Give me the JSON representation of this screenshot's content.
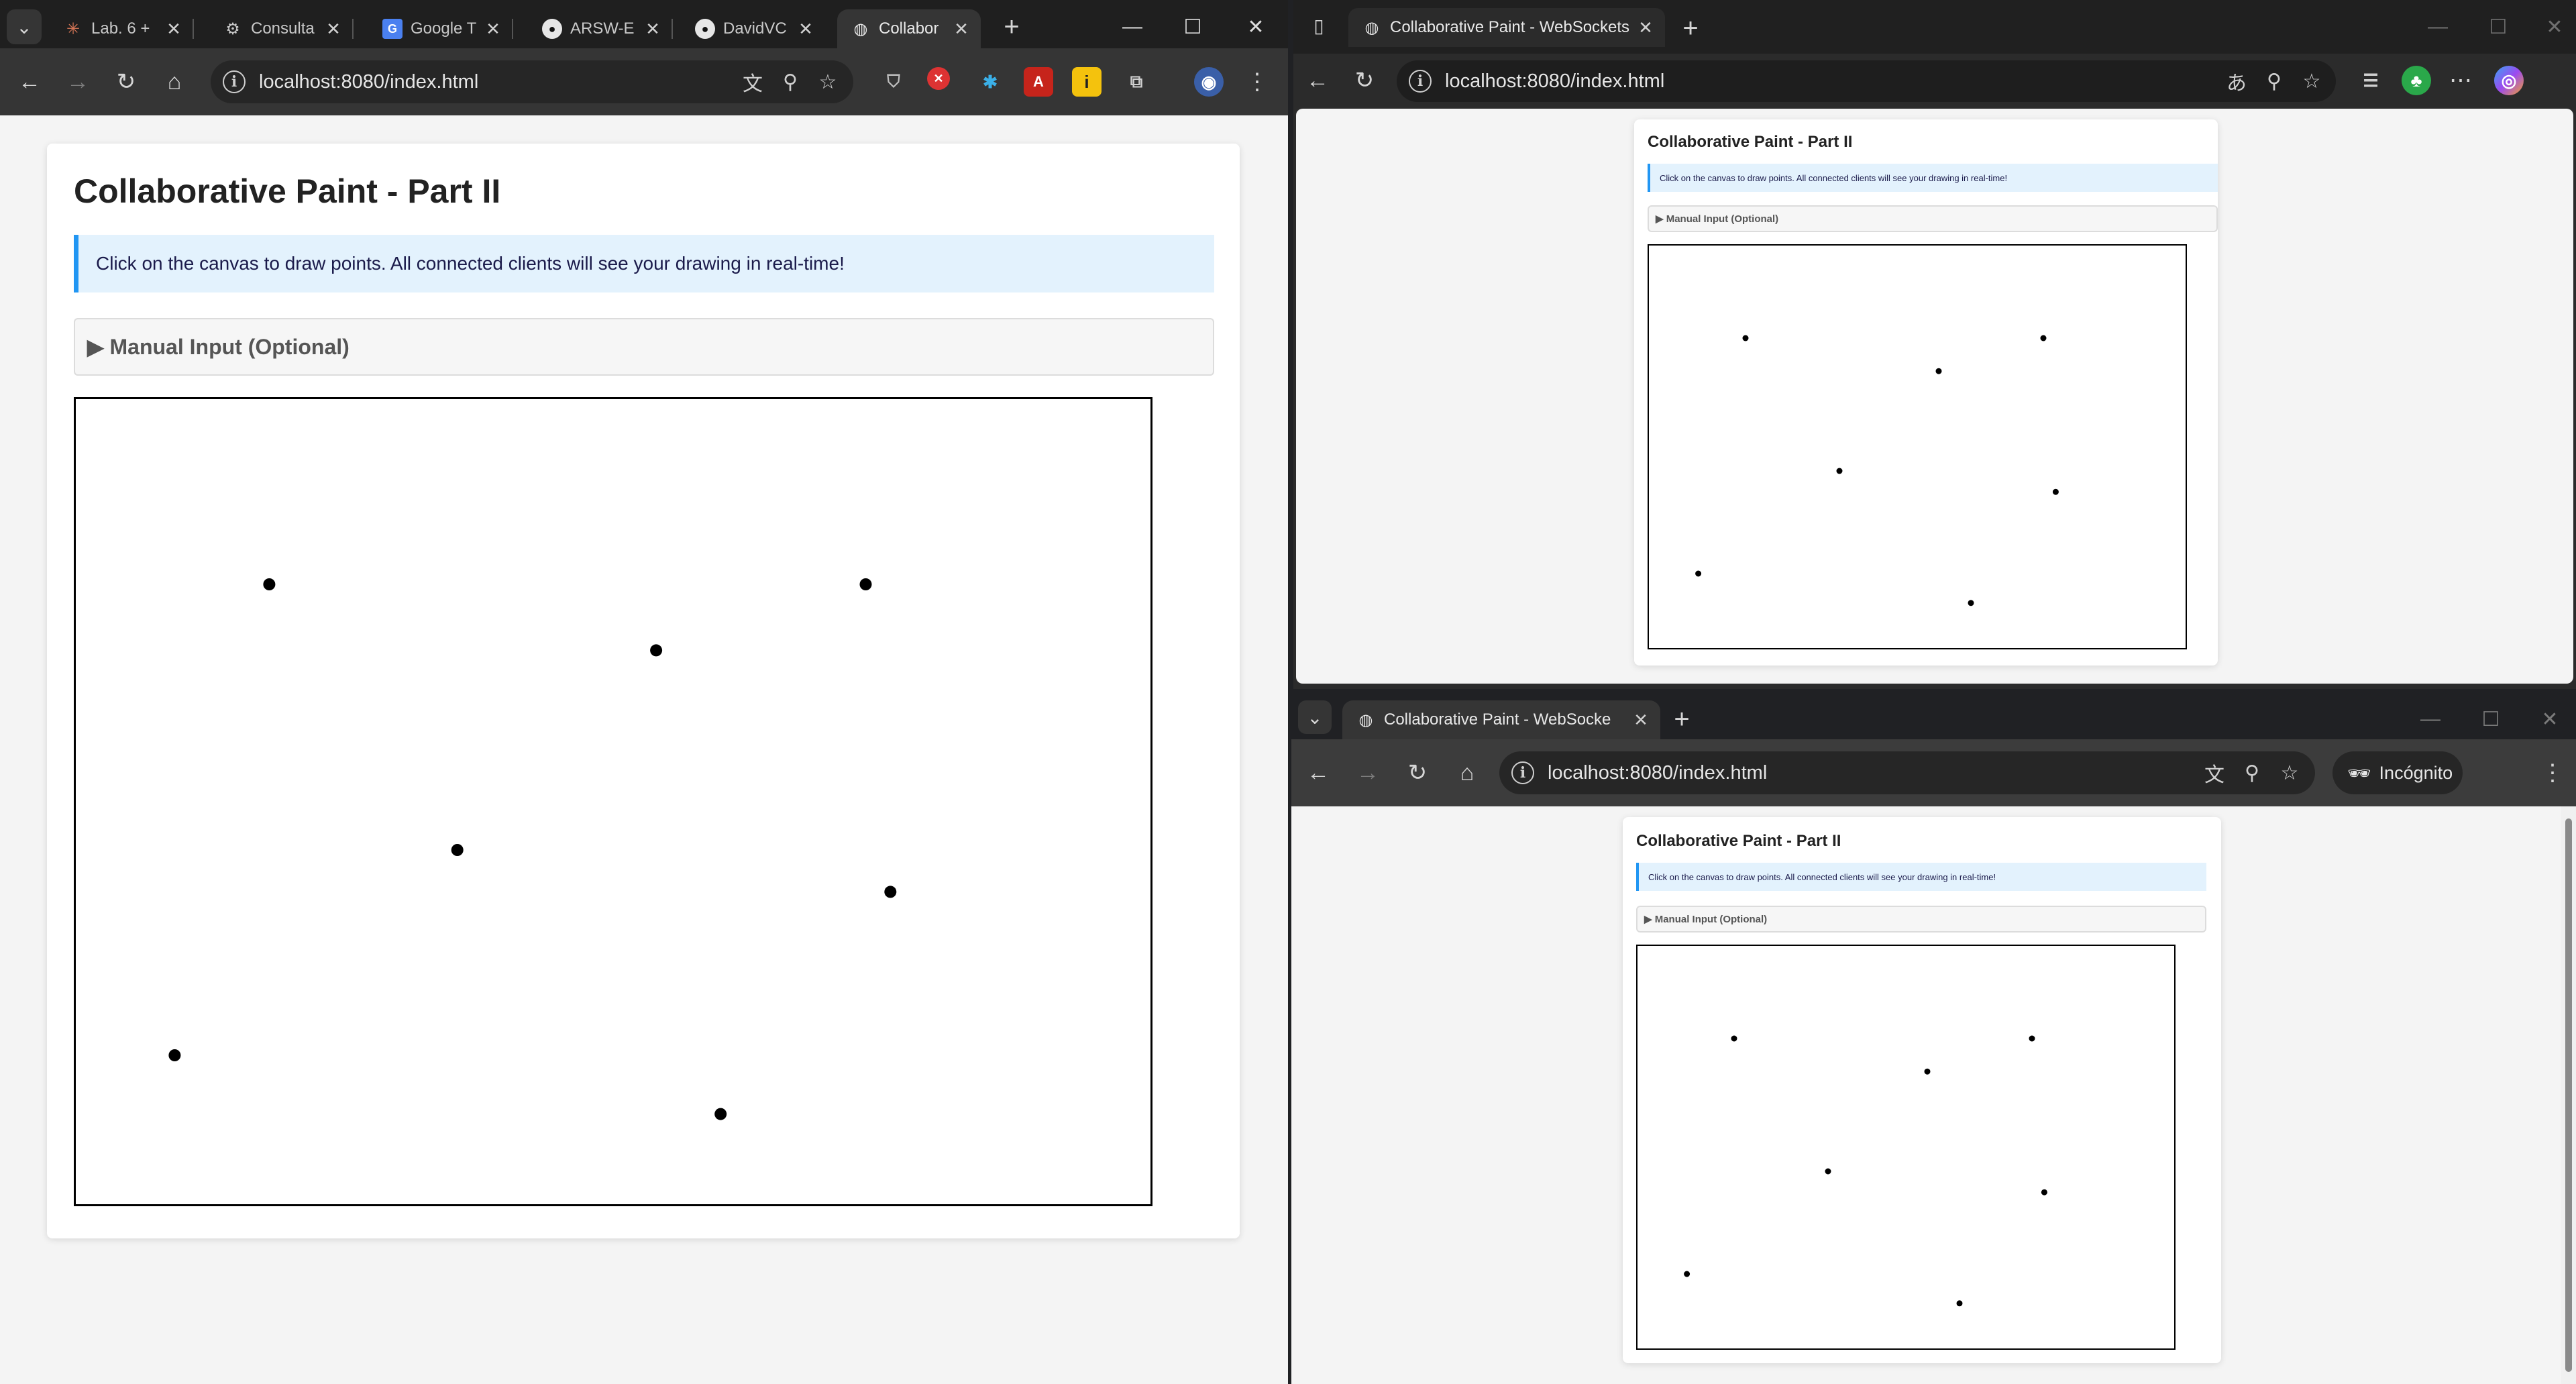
{
  "shared_page": {
    "heading": "Collaborative Paint - Part II",
    "info_text": "Click on the canvas to draw points. All connected clients will see your drawing in real-time!",
    "manual_toggle": "▶ Manual Input (Optional)",
    "points": [
      {
        "x": 0.18,
        "y": 0.23
      },
      {
        "x": 0.735,
        "y": 0.23
      },
      {
        "x": 0.54,
        "y": 0.312
      },
      {
        "x": 0.355,
        "y": 0.56
      },
      {
        "x": 0.758,
        "y": 0.612
      },
      {
        "x": 0.092,
        "y": 0.815
      },
      {
        "x": 0.6,
        "y": 0.888
      }
    ]
  },
  "left_window": {
    "tabs": [
      {
        "title": "Lab. 6 +",
        "icon": "asterisk-icon"
      },
      {
        "title": "Consulta",
        "icon": "openai-icon"
      },
      {
        "title": "Google T",
        "icon": "google-translate-icon"
      },
      {
        "title": "ARSW-E",
        "icon": "github-icon"
      },
      {
        "title": "DavidVC",
        "icon": "github-icon"
      },
      {
        "title": "Collabor",
        "icon": "globe-icon"
      }
    ],
    "url": "localhost:8080/index.html"
  },
  "edge_window": {
    "tab_title": "Collaborative Paint - WebSockets",
    "url": "localhost:8080/index.html"
  },
  "incognito_window": {
    "tab_title": "Collaborative Paint - WebSocke",
    "url": "localhost:8080/index.html",
    "incognito_label": "Incógnito"
  },
  "glyphs": {
    "tab_menu": "⌄",
    "close": "✕",
    "plus": "+",
    "minimize": "—",
    "maximize": "☐",
    "back": "←",
    "forward": "→",
    "reload": "↻",
    "home": "⌂",
    "info": "i",
    "translate": "文",
    "zoom": "⚲",
    "star": "☆",
    "more": "⋮",
    "aa": "あ",
    "favorites": "☆",
    "sidebar": "▯"
  },
  "colors": {
    "accent_blue": "#2196f3",
    "info_bg": "#e3f2fd",
    "chrome_toolbar": "#353535",
    "page_bg": "#f4f4f4"
  }
}
